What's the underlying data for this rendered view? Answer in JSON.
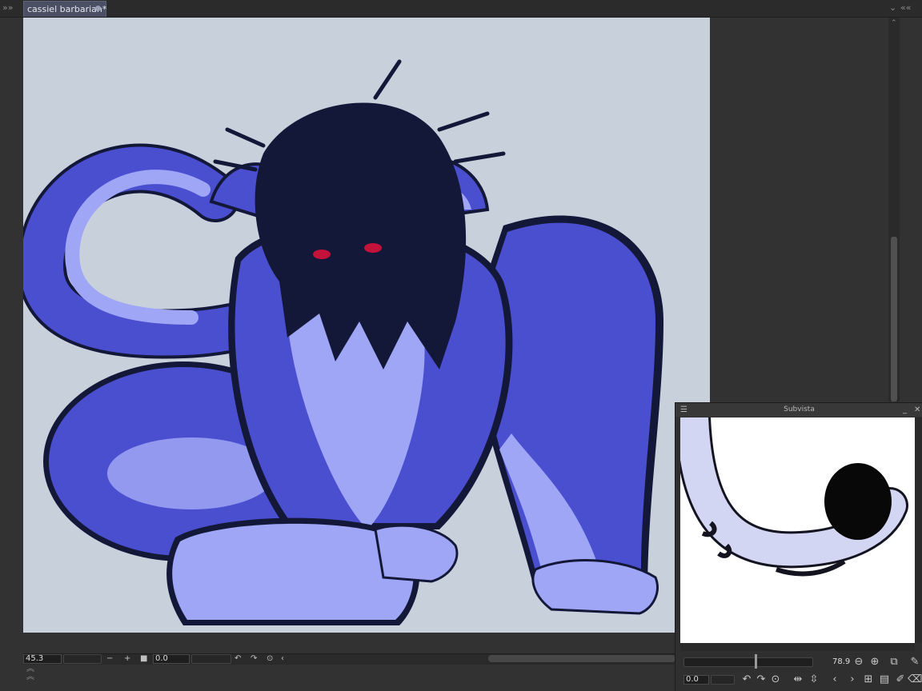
{
  "document": {
    "tab_title": "cassiel barbarian*"
  },
  "status_bar": {
    "zoom": "45.3",
    "rotation": "0.0"
  },
  "subvista": {
    "title": "Subvista",
    "zoom": "78.9",
    "rotation": "0.0",
    "zoom_slider_level": 0.55
  },
  "colors": {
    "canvas_bg": "#c8d0dc",
    "body": "#4a4fcf",
    "light": "#9fa6f5",
    "hair": "#141838",
    "eyes": "#c3123a"
  },
  "icons": [
    "collapse-left-icon",
    "chevron-down-icon",
    "collapse-right-icon",
    "zoom-out-icon",
    "zoom-in-icon",
    "fit-icon",
    "rotate-left-icon",
    "rotate-right-icon",
    "reset-rotation-icon",
    "flip-horizontal-icon",
    "flip-vertical-icon",
    "prev-image-icon",
    "next-image-icon",
    "grid-icon",
    "open-folder-icon",
    "edit-icon",
    "trash-icon",
    "eyedropper-icon",
    "navigator-icon",
    "panel-menu-icon",
    "minimize-icon",
    "close-icon"
  ]
}
